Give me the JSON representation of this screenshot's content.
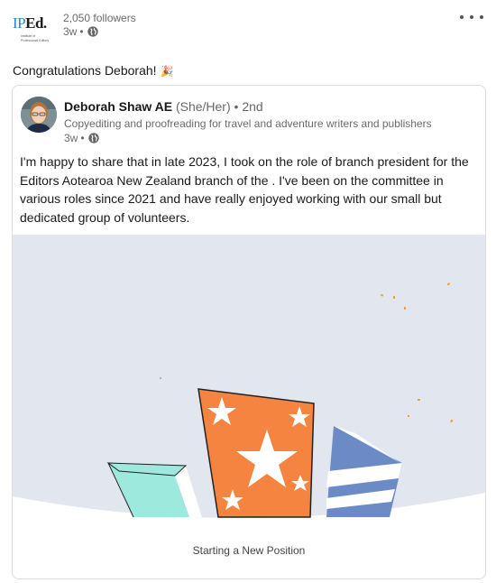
{
  "org": {
    "logo_abbr_ip": "IP",
    "logo_abbr_ed": "Ed.",
    "logo_sub": "Institute of Professional Editors",
    "followers": "2,050 followers",
    "time": "3w",
    "visibility_icon": "globe-icon"
  },
  "post": {
    "text": "Congratulations Deborah!",
    "emoji": "🎉"
  },
  "shared": {
    "author_name": "Deborah Shaw AE",
    "pronouns": "(She/Her)",
    "degree": "• 2nd",
    "headline": "Copyediting and proofreading for travel and adventure writers and publishers",
    "time": "3w",
    "body": "I'm happy to share that in late 2023, I took on the role of branch president for the Editors Aotearoa New Zealand branch of the . I've been on the committee in various roles since 2021 and have really enjoyed working with our small but dedicated group of volunteers.",
    "caption": "Starting a New Position"
  },
  "colors": {
    "illustration_bg": "#e2e7ef",
    "orange": "#f4843f",
    "teal": "#9de9de",
    "blue": "#6b8ac6",
    "confetti": "#e8a33c"
  }
}
